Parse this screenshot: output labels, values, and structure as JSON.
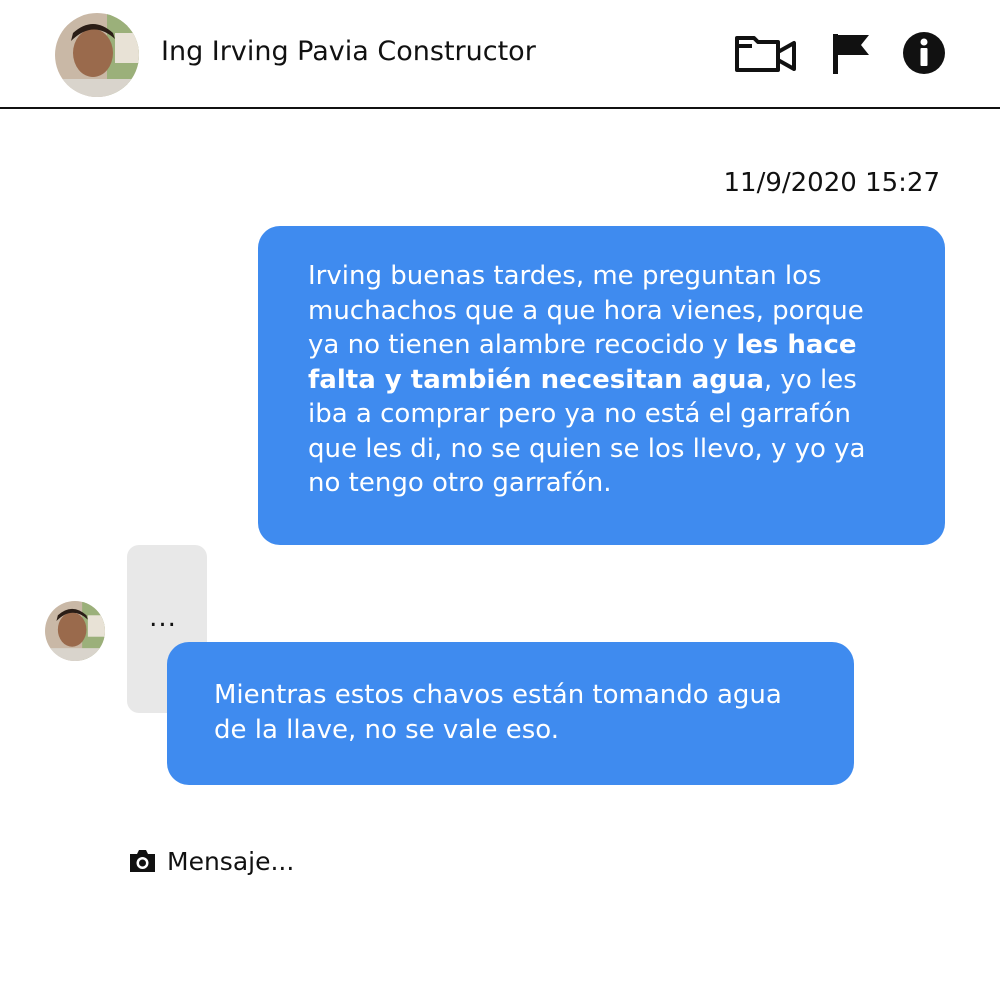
{
  "header": {
    "contact_name": "Ing Irving Pavia Constructor",
    "icons": [
      "video-camera-icon",
      "flag-icon",
      "info-icon"
    ]
  },
  "conversation": {
    "timestamp": "11/9/2020 15:27",
    "messages": [
      {
        "direction": "outgoing",
        "text_before": "Irving buenas tardes, me preguntan los muchachos que a que hora vienes, porque ya no tienen alambre recocido y ",
        "text_bold": "les hace falta y también necesitan agua",
        "text_after": ", yo les iba a comprar pero ya no está el garrafón que les di, no se quien se los llevo, y yo ya no tengo otro garrafón."
      },
      {
        "direction": "incoming-typing",
        "text": "..."
      },
      {
        "direction": "outgoing",
        "text": "Mientras estos chavos están tomando agua de la llave, no se vale eso."
      }
    ]
  },
  "composer": {
    "placeholder": "Mensaje...",
    "icon": "camera-icon"
  },
  "colors": {
    "bubble": "#3f8bef",
    "bubble_text": "#ffffff",
    "typing_bubble": "#e8e8e8",
    "divider": "#111111"
  }
}
